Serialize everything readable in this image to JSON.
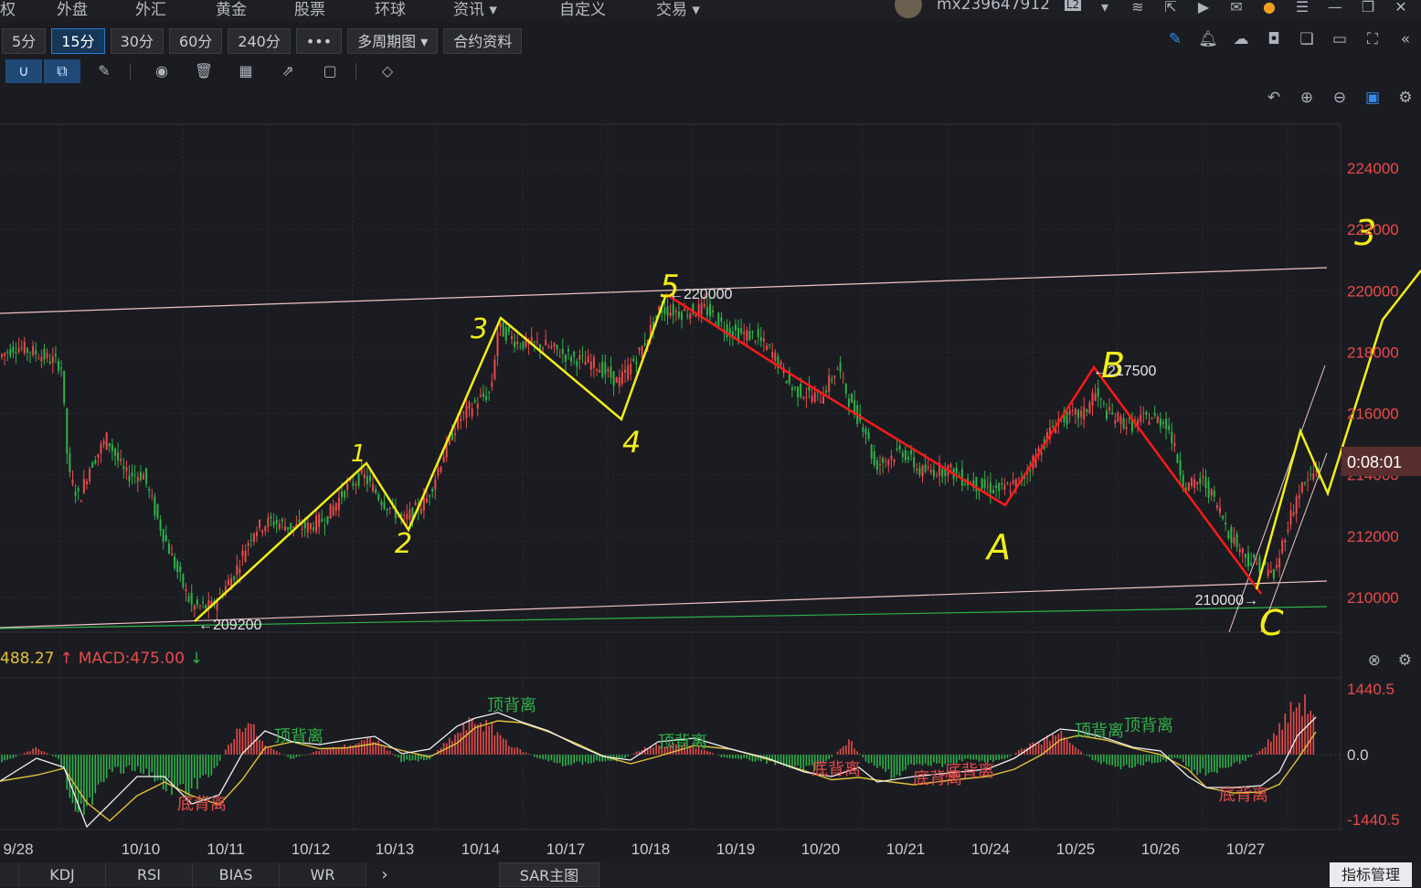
{
  "top_menu": [
    "权",
    "外盘",
    "外汇",
    "黄金",
    "股票",
    "环球",
    "资讯 ▾",
    "自定义",
    "交易 ▾"
  ],
  "user": {
    "name": "mx239647912",
    "badge": "L2"
  },
  "periods": [
    {
      "label": "5分",
      "active": false
    },
    {
      "label": "15分",
      "active": true
    },
    {
      "label": "30分",
      "active": false
    },
    {
      "label": "60分",
      "active": false
    },
    {
      "label": "240分",
      "active": false
    },
    {
      "label": "•••",
      "active": false
    },
    {
      "label": "多周期图 ▾",
      "active": false
    },
    {
      "label": "合约资料",
      "active": false
    }
  ],
  "price_axis": [
    "224000",
    "222000",
    "220000",
    "218000",
    "216000",
    "214000",
    "212000",
    "210000"
  ],
  "countdown": "0:08:01",
  "annotations": {
    "high_5": "220000",
    "low_start": "209200",
    "high_b": "217500",
    "low_c": "210000",
    "wave_labels": [
      "1",
      "2",
      "3",
      "4",
      "5",
      "A",
      "B",
      "C",
      "3"
    ]
  },
  "macd": {
    "dif_label": "488.27",
    "macd_label": "MACD:475.00",
    "axis": [
      "1440.5",
      "0.0",
      "-1440.5"
    ],
    "signals_top": [
      "顶背离",
      "顶背离",
      "顶背离",
      "顶背离",
      "顶背离"
    ],
    "signals_bottom": [
      "底背离",
      "底背离",
      "底背离",
      "底背离",
      "底背离"
    ]
  },
  "date_axis": [
    "9/28",
    "10/10",
    "10/11",
    "10/12",
    "10/13",
    "10/14",
    "10/17",
    "10/18",
    "10/19",
    "10/20",
    "10/21",
    "10/24",
    "10/25",
    "10/26",
    "10/27"
  ],
  "tabs": [
    "KDJ",
    "RSI",
    "BIAS",
    "WR"
  ],
  "sar_label": "SAR主图",
  "indicator_manage": "指标管理",
  "colors": {
    "up": "#e84b4b",
    "down": "#2fb24a",
    "axis_red": "#e84b4b",
    "yellow": "#f2ee18",
    "wave_red": "#ff1a1a"
  }
}
